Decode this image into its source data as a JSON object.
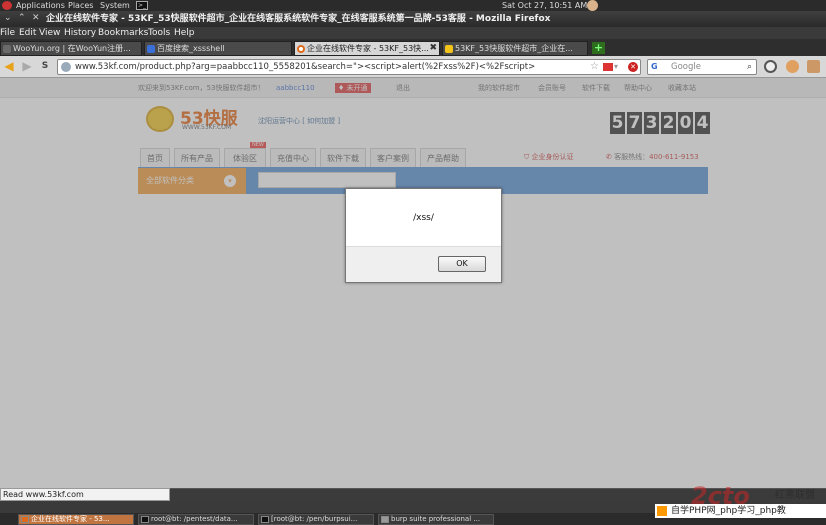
{
  "panel": {
    "applications": "Applications",
    "places": "Places",
    "system": "System",
    "clock": "Sat Oct 27, 10:51 AM"
  },
  "window": {
    "title": "企业在线软件专家 - 53KF_53快服软件超市_企业在线客服系统软件专家_在线客服系统第一品牌-53客服 - Mozilla Firefox"
  },
  "menu": [
    "File",
    "Edit",
    "View",
    "History",
    "Bookmarks",
    "Tools",
    "Help"
  ],
  "tabs": [
    {
      "label": "WooYun.org | 在WooYun注册...",
      "active": false
    },
    {
      "label": "百度搜索_xssshell",
      "active": false
    },
    {
      "label": "企业在线软件专家 - 53KF_53快...",
      "active": true
    },
    {
      "label": "53KF_53快服软件超市_企业在...",
      "active": false
    }
  ],
  "nav": {
    "url": "www.53kf.com/product.php?arg=paabbcc110_5558201&search=\"><script>alert(%2Fxss%2F)<%2Fscript>",
    "search_placeholder": "Google",
    "search_engine_icon": "G"
  },
  "site": {
    "welcome": "欢迎来到53KF.com，53快服软件超市！",
    "username": "aabbcc110",
    "vip": "♦ 未开通",
    "logout": "退出",
    "top_links": [
      "我的软件超市",
      "会员账号",
      "软件下载",
      "帮助中心",
      "收藏本站"
    ],
    "logo_text": "53快服",
    "logo_sub": "WWW.53KF.COM",
    "city": "沈阳运营中心 [ 如何加盟 ]",
    "counter_digits": [
      "5",
      "7",
      "3",
      "2",
      "0",
      "4"
    ],
    "nav_items": [
      "首页",
      "所有产品",
      "体验区",
      "充值中心",
      "软件下载",
      "客户案例",
      "产品帮助"
    ],
    "new_badge": "NEW",
    "auth": "企业身份认证",
    "hotline_label": "客服热线：",
    "hotline_number": "400-611-9153",
    "category_button": "全部软件分类"
  },
  "dialog": {
    "message": "/xss/",
    "ok_label": "OK"
  },
  "status": {
    "text": "Read www.53kf.com",
    "close": "✖"
  },
  "taskbar": [
    {
      "label": "企业在线软件专家 - 53...",
      "active": true
    },
    {
      "label": "root@bt: /pentest/data...",
      "active": false
    },
    {
      "label": "[root@bt: /pen/burpsui...",
      "active": false
    },
    {
      "label": "burp suite professional ...",
      "active": false
    }
  ],
  "watermark": {
    "big": "2cto",
    "cn": "红黑联盟",
    "strip": "自学PHP网_php学习_php教"
  }
}
